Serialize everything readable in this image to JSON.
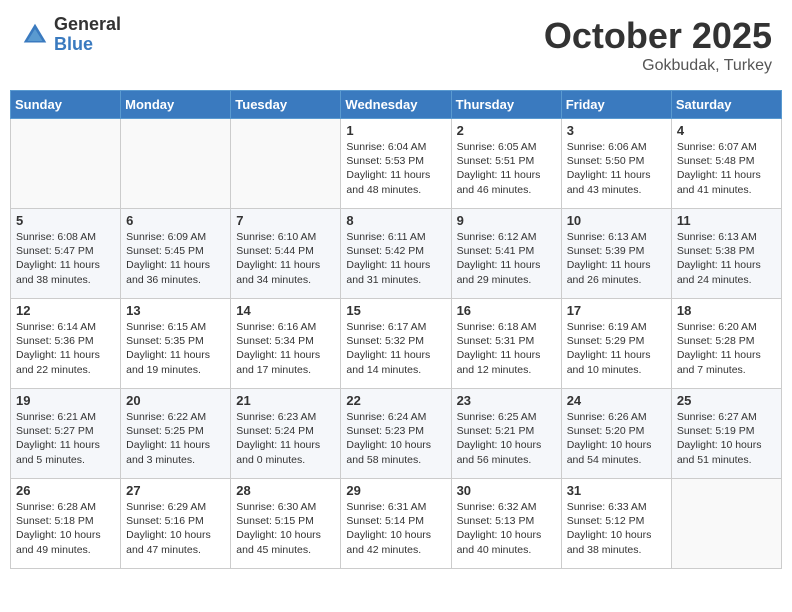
{
  "header": {
    "logo_general": "General",
    "logo_blue": "Blue",
    "month_title": "October 2025",
    "location": "Gokbudak, Turkey"
  },
  "calendar": {
    "weekdays": [
      "Sunday",
      "Monday",
      "Tuesday",
      "Wednesday",
      "Thursday",
      "Friday",
      "Saturday"
    ],
    "weeks": [
      [
        {
          "day": "",
          "info": ""
        },
        {
          "day": "",
          "info": ""
        },
        {
          "day": "",
          "info": ""
        },
        {
          "day": "1",
          "info": "Sunrise: 6:04 AM\nSunset: 5:53 PM\nDaylight: 11 hours\nand 48 minutes."
        },
        {
          "day": "2",
          "info": "Sunrise: 6:05 AM\nSunset: 5:51 PM\nDaylight: 11 hours\nand 46 minutes."
        },
        {
          "day": "3",
          "info": "Sunrise: 6:06 AM\nSunset: 5:50 PM\nDaylight: 11 hours\nand 43 minutes."
        },
        {
          "day": "4",
          "info": "Sunrise: 6:07 AM\nSunset: 5:48 PM\nDaylight: 11 hours\nand 41 minutes."
        }
      ],
      [
        {
          "day": "5",
          "info": "Sunrise: 6:08 AM\nSunset: 5:47 PM\nDaylight: 11 hours\nand 38 minutes."
        },
        {
          "day": "6",
          "info": "Sunrise: 6:09 AM\nSunset: 5:45 PM\nDaylight: 11 hours\nand 36 minutes."
        },
        {
          "day": "7",
          "info": "Sunrise: 6:10 AM\nSunset: 5:44 PM\nDaylight: 11 hours\nand 34 minutes."
        },
        {
          "day": "8",
          "info": "Sunrise: 6:11 AM\nSunset: 5:42 PM\nDaylight: 11 hours\nand 31 minutes."
        },
        {
          "day": "9",
          "info": "Sunrise: 6:12 AM\nSunset: 5:41 PM\nDaylight: 11 hours\nand 29 minutes."
        },
        {
          "day": "10",
          "info": "Sunrise: 6:13 AM\nSunset: 5:39 PM\nDaylight: 11 hours\nand 26 minutes."
        },
        {
          "day": "11",
          "info": "Sunrise: 6:13 AM\nSunset: 5:38 PM\nDaylight: 11 hours\nand 24 minutes."
        }
      ],
      [
        {
          "day": "12",
          "info": "Sunrise: 6:14 AM\nSunset: 5:36 PM\nDaylight: 11 hours\nand 22 minutes."
        },
        {
          "day": "13",
          "info": "Sunrise: 6:15 AM\nSunset: 5:35 PM\nDaylight: 11 hours\nand 19 minutes."
        },
        {
          "day": "14",
          "info": "Sunrise: 6:16 AM\nSunset: 5:34 PM\nDaylight: 11 hours\nand 17 minutes."
        },
        {
          "day": "15",
          "info": "Sunrise: 6:17 AM\nSunset: 5:32 PM\nDaylight: 11 hours\nand 14 minutes."
        },
        {
          "day": "16",
          "info": "Sunrise: 6:18 AM\nSunset: 5:31 PM\nDaylight: 11 hours\nand 12 minutes."
        },
        {
          "day": "17",
          "info": "Sunrise: 6:19 AM\nSunset: 5:29 PM\nDaylight: 11 hours\nand 10 minutes."
        },
        {
          "day": "18",
          "info": "Sunrise: 6:20 AM\nSunset: 5:28 PM\nDaylight: 11 hours\nand 7 minutes."
        }
      ],
      [
        {
          "day": "19",
          "info": "Sunrise: 6:21 AM\nSunset: 5:27 PM\nDaylight: 11 hours\nand 5 minutes."
        },
        {
          "day": "20",
          "info": "Sunrise: 6:22 AM\nSunset: 5:25 PM\nDaylight: 11 hours\nand 3 minutes."
        },
        {
          "day": "21",
          "info": "Sunrise: 6:23 AM\nSunset: 5:24 PM\nDaylight: 11 hours\nand 0 minutes."
        },
        {
          "day": "22",
          "info": "Sunrise: 6:24 AM\nSunset: 5:23 PM\nDaylight: 10 hours\nand 58 minutes."
        },
        {
          "day": "23",
          "info": "Sunrise: 6:25 AM\nSunset: 5:21 PM\nDaylight: 10 hours\nand 56 minutes."
        },
        {
          "day": "24",
          "info": "Sunrise: 6:26 AM\nSunset: 5:20 PM\nDaylight: 10 hours\nand 54 minutes."
        },
        {
          "day": "25",
          "info": "Sunrise: 6:27 AM\nSunset: 5:19 PM\nDaylight: 10 hours\nand 51 minutes."
        }
      ],
      [
        {
          "day": "26",
          "info": "Sunrise: 6:28 AM\nSunset: 5:18 PM\nDaylight: 10 hours\nand 49 minutes."
        },
        {
          "day": "27",
          "info": "Sunrise: 6:29 AM\nSunset: 5:16 PM\nDaylight: 10 hours\nand 47 minutes."
        },
        {
          "day": "28",
          "info": "Sunrise: 6:30 AM\nSunset: 5:15 PM\nDaylight: 10 hours\nand 45 minutes."
        },
        {
          "day": "29",
          "info": "Sunrise: 6:31 AM\nSunset: 5:14 PM\nDaylight: 10 hours\nand 42 minutes."
        },
        {
          "day": "30",
          "info": "Sunrise: 6:32 AM\nSunset: 5:13 PM\nDaylight: 10 hours\nand 40 minutes."
        },
        {
          "day": "31",
          "info": "Sunrise: 6:33 AM\nSunset: 5:12 PM\nDaylight: 10 hours\nand 38 minutes."
        },
        {
          "day": "",
          "info": ""
        }
      ]
    ]
  }
}
